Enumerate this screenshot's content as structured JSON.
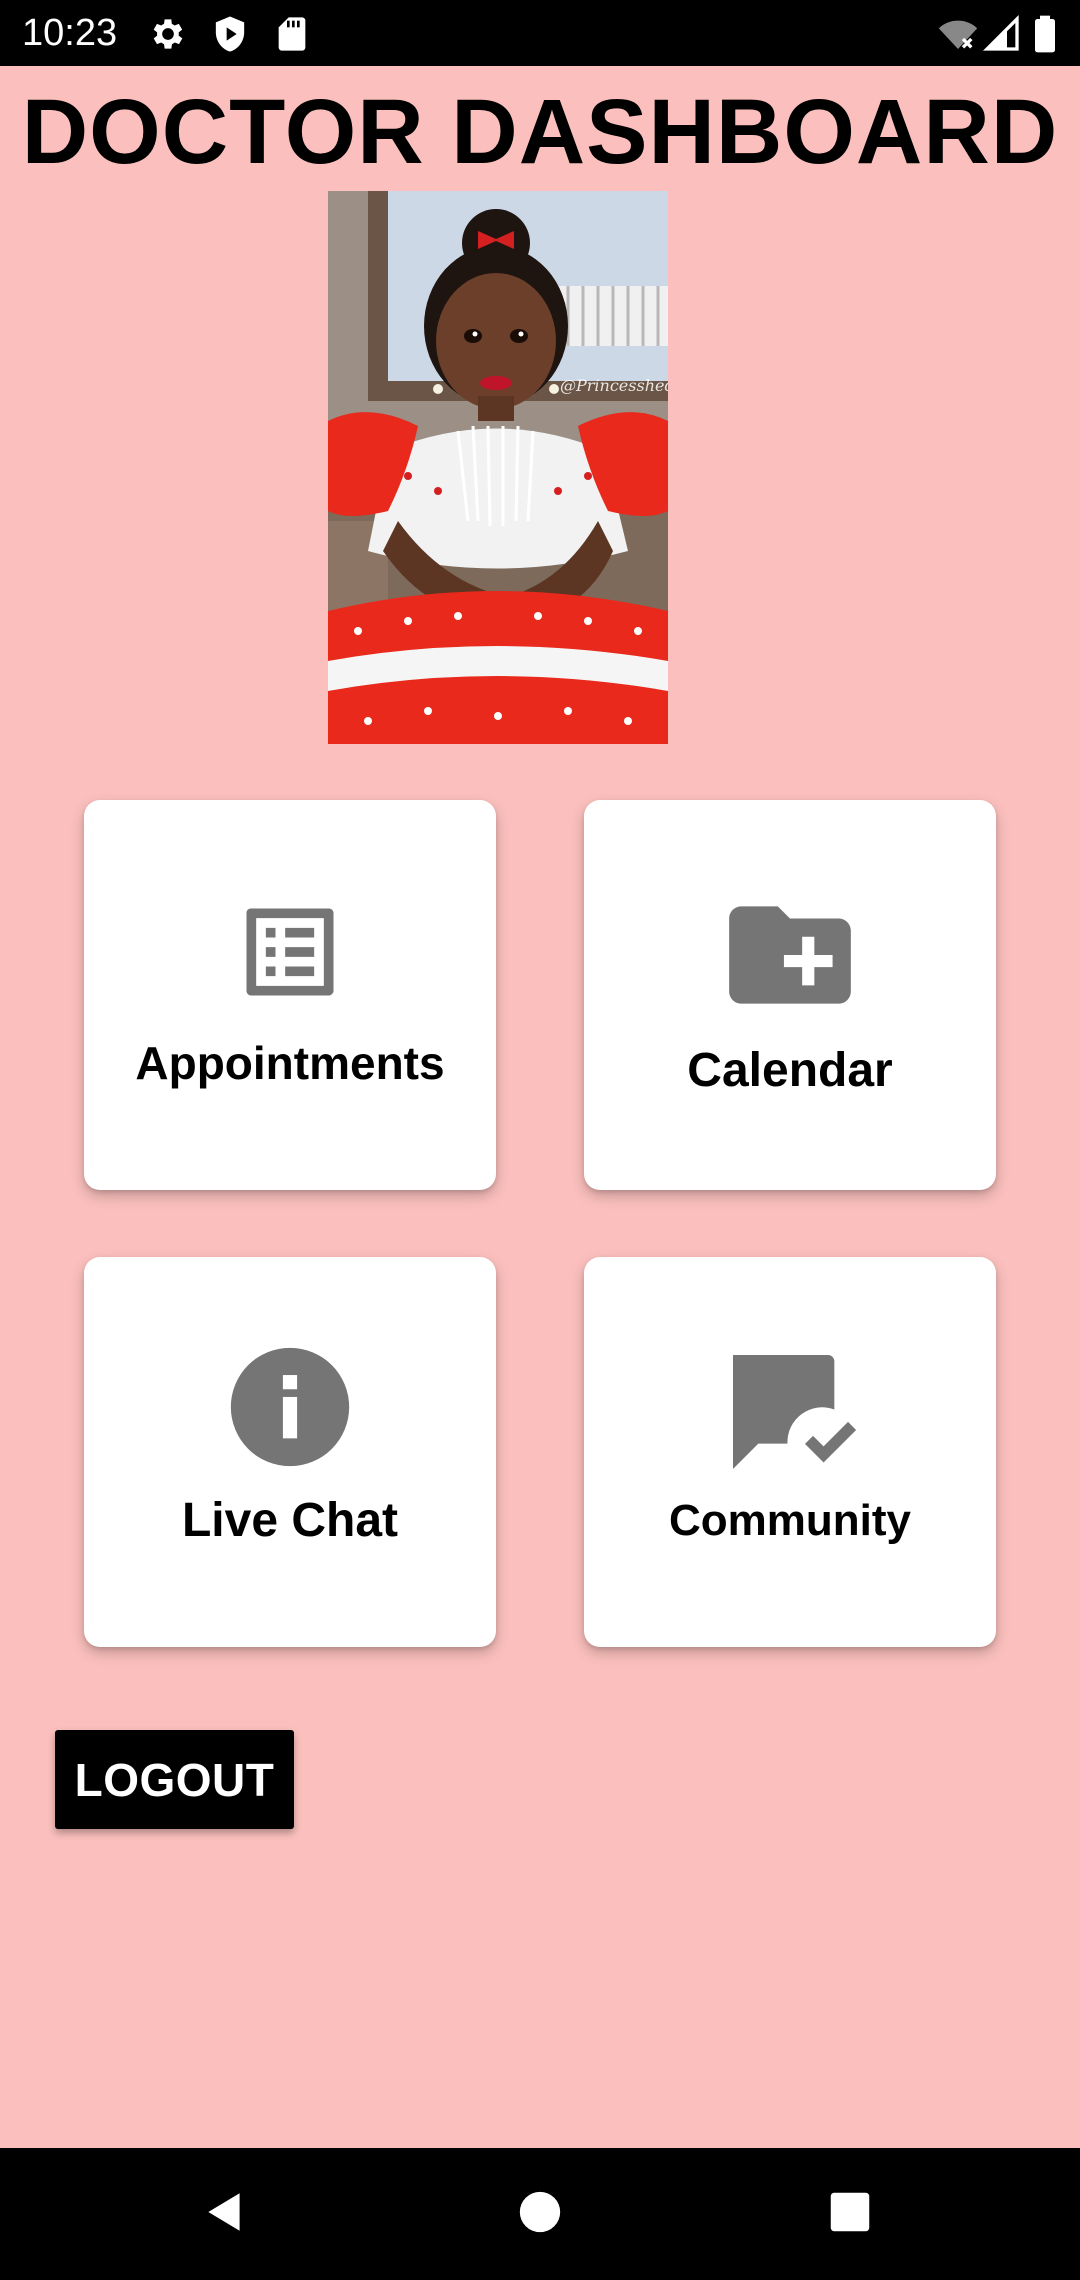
{
  "status_bar": {
    "time": "10:23",
    "left_icons": [
      "gear-icon",
      "shield-play-icon",
      "sd-card-icon"
    ],
    "right_icons": [
      "wifi-off-icon",
      "cell-signal-icon",
      "battery-icon"
    ]
  },
  "header": {
    "title": "DOCTOR DASHBOARD"
  },
  "profile": {
    "watermark": "@Princesshedo"
  },
  "cards": {
    "appointments": {
      "label": "Appointments",
      "icon": "list-icon"
    },
    "calendar": {
      "label": "Calendar",
      "icon": "folder-add-icon"
    },
    "live_chat": {
      "label": "Live Chat",
      "icon": "info-icon"
    },
    "community": {
      "label": "Community",
      "icon": "chat-check-icon"
    }
  },
  "actions": {
    "logout_label": "LOGOUT"
  },
  "nav_bar": {
    "buttons": [
      "back-icon",
      "home-icon",
      "recents-icon"
    ]
  },
  "colors": {
    "background": "#fbc0bd",
    "card": "#ffffff",
    "icon_gray": "#757575",
    "bar_black": "#000000"
  }
}
